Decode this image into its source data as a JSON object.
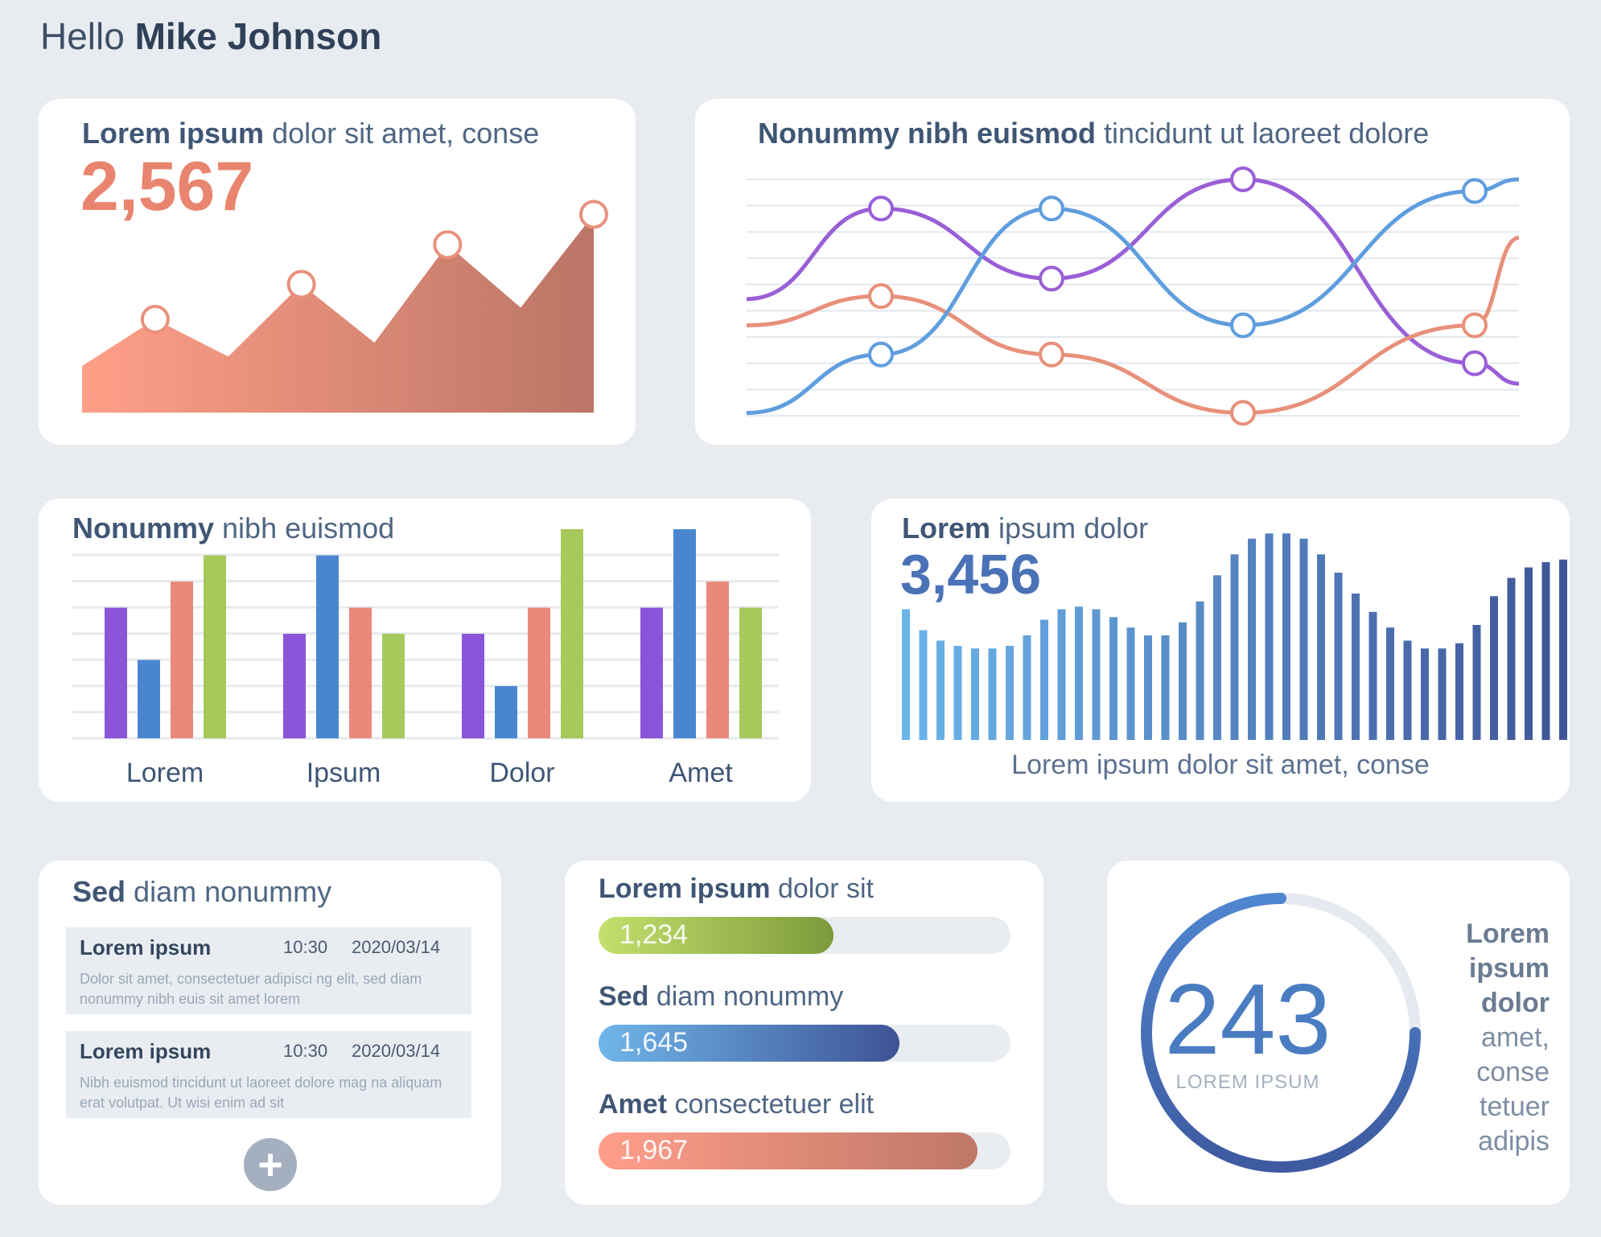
{
  "greeting": {
    "prefix": "Hello",
    "name": "Mike Johnson"
  },
  "card1": {
    "title_bold": "Lorem ipsum",
    "title_rest": "dolor sit amet, conse",
    "value": "2,567",
    "chart_data": {
      "type": "area",
      "points": [
        20,
        40,
        24,
        55,
        30,
        72,
        45,
        85
      ]
    }
  },
  "card2": {
    "title_bold": "Nonummy nibh euismod",
    "title_rest": "tincidunt ut laoreet dolore",
    "chart_data": {
      "type": "line",
      "series": [
        {
          "color": "#9a5fd6",
          "values": [
            40,
            71,
            47,
            81,
            18,
            11
          ]
        },
        {
          "color": "#e8907a",
          "values": [
            31,
            41,
            21,
            1,
            31,
            61
          ]
        },
        {
          "color": "#5f9ede",
          "values": [
            1,
            21,
            71,
            31,
            77,
            81
          ]
        }
      ]
    }
  },
  "card3": {
    "title_bold": "Nonummy",
    "title_rest": "nibh euismod",
    "chart_data": {
      "type": "bar",
      "categories": [
        "Lorem",
        "Ipsum",
        "Dolor",
        "Amet"
      ],
      "series": [
        {
          "color": "#8a55d8",
          "values": [
            5,
            4,
            4,
            5
          ]
        },
        {
          "color": "#4a86d0",
          "values": [
            3,
            7,
            2,
            8
          ]
        },
        {
          "color": "#e9897a",
          "values": [
            6,
            5,
            5,
            6
          ]
        },
        {
          "color": "#a7c85a",
          "values": [
            7,
            4,
            8,
            5
          ]
        }
      ],
      "ylim": [
        0,
        8
      ]
    }
  },
  "card4": {
    "title_bold": "Lorem",
    "title_rest": "ipsum dolor",
    "value": "3,456",
    "caption": "Lorem ipsum dolor sit amet, conse",
    "chart_data": {
      "type": "bar",
      "values": [
        50,
        42,
        38,
        36,
        35,
        35,
        36,
        40,
        46,
        50,
        51,
        50,
        47,
        43,
        40,
        40,
        45,
        53,
        63,
        71,
        77,
        79,
        79,
        77,
        71,
        64,
        56,
        49,
        43,
        38,
        35,
        35,
        37,
        44,
        55,
        62,
        66,
        68,
        69
      ],
      "ylim": [
        0,
        80
      ]
    }
  },
  "card5": {
    "title_bold": "Sed",
    "title_rest": "diam nonummy",
    "items": [
      {
        "title": "Lorem ipsum",
        "time": "10:30",
        "date": "2020/03/14",
        "body": "Dolor sit amet, consectetuer adipisci ng elit, sed diam nonummy nibh euis sit amet lorem"
      },
      {
        "title": "Lorem ipsum",
        "time": "10:30",
        "date": "2020/03/14",
        "body": "Nibh euismod tincidunt ut laoreet dolore mag na aliquam erat volutpat. Ut wisi enim ad sit"
      }
    ],
    "add_icon": "plus-icon"
  },
  "card6": {
    "bars": [
      {
        "label_bold": "Lorem ipsum",
        "label_rest": "dolor sit",
        "value": "1,234",
        "fraction": 0.57,
        "color_from": "#c3e06c",
        "color_to": "#7d9a3c"
      },
      {
        "label_bold": "Sed",
        "label_rest": "diam nonummy",
        "value": "1,645",
        "fraction": 0.73,
        "color_from": "#6fb6ea",
        "color_to": "#3e5396"
      },
      {
        "label_bold": "Amet",
        "label_rest": "consectetuer elit",
        "value": "1,967",
        "fraction": 0.92,
        "color_from": "#ff9e8a",
        "color_to": "#bf7767"
      }
    ]
  },
  "card7": {
    "value": "243",
    "label": "LOREM IPSUM",
    "fraction": 0.75,
    "side_bold": "Lorem ipsum dolor",
    "side_rest": "amet, conse tetuer adipis"
  }
}
